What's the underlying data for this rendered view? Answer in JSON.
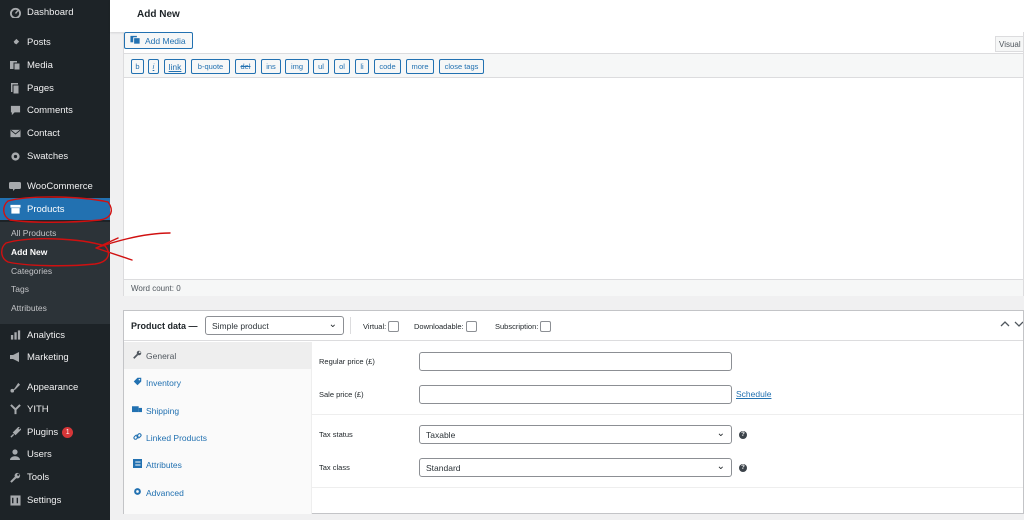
{
  "sidebar": {
    "items": [
      {
        "label": "Dashboard",
        "icon": "dashboard-icon"
      },
      {
        "label": "Posts",
        "icon": "pin-icon"
      },
      {
        "label": "Media",
        "icon": "media-icon"
      },
      {
        "label": "Pages",
        "icon": "pages-icon"
      },
      {
        "label": "Comments",
        "icon": "comment-icon"
      },
      {
        "label": "Contact",
        "icon": "mail-icon"
      },
      {
        "label": "Swatches",
        "icon": "gear-icon"
      },
      {
        "label": "WooCommerce",
        "icon": "woo-icon"
      },
      {
        "label": "Products",
        "icon": "archive-icon"
      },
      {
        "label": "Analytics",
        "icon": "bar-chart-icon"
      },
      {
        "label": "Marketing",
        "icon": "megaphone-icon"
      },
      {
        "label": "Appearance",
        "icon": "brush-icon"
      },
      {
        "label": "YITH",
        "icon": "yith-icon"
      },
      {
        "label": "Plugins",
        "icon": "plug-icon",
        "badge": "1"
      },
      {
        "label": "Users",
        "icon": "user-icon"
      },
      {
        "label": "Tools",
        "icon": "wrench-icon"
      },
      {
        "label": "Settings",
        "icon": "settings-icon"
      }
    ],
    "submenu": [
      {
        "label": "All Products"
      },
      {
        "label": "Add New"
      },
      {
        "label": "Categories"
      },
      {
        "label": "Tags"
      },
      {
        "label": "Attributes"
      }
    ]
  },
  "header": {
    "title": "Add New"
  },
  "editor": {
    "add_media_label": "Add Media",
    "visual_tab": "Visual",
    "quicktags": [
      "b",
      "i",
      "link",
      "b-quote",
      "del",
      "ins",
      "img",
      "ul",
      "ol",
      "li",
      "code",
      "more",
      "close tags"
    ],
    "word_count": "Word count: 0"
  },
  "product_data": {
    "title": "Product data —",
    "type_select": "Simple product",
    "virtual_label": "Virtual:",
    "downloadable_label": "Downloadable:",
    "subscription_label": "Subscription:",
    "tabs": [
      {
        "label": "General",
        "icon": "wrench-icon"
      },
      {
        "label": "Inventory",
        "icon": "tag-icon"
      },
      {
        "label": "Shipping",
        "icon": "truck-icon"
      },
      {
        "label": "Linked Products",
        "icon": "link-icon"
      },
      {
        "label": "Attributes",
        "icon": "list-icon"
      },
      {
        "label": "Advanced",
        "icon": "gear-icon"
      }
    ],
    "fields": {
      "regular_price_label": "Regular price (£)",
      "sale_price_label": "Sale price (£)",
      "schedule_link": "Schedule",
      "tax_status_label": "Tax status",
      "tax_status_value": "Taxable",
      "tax_class_label": "Tax class",
      "tax_class_value": "Standard"
    }
  },
  "colors": {
    "sidebar_bg": "#1d2327",
    "accent": "#2271b1",
    "annotation": "#d01010"
  }
}
